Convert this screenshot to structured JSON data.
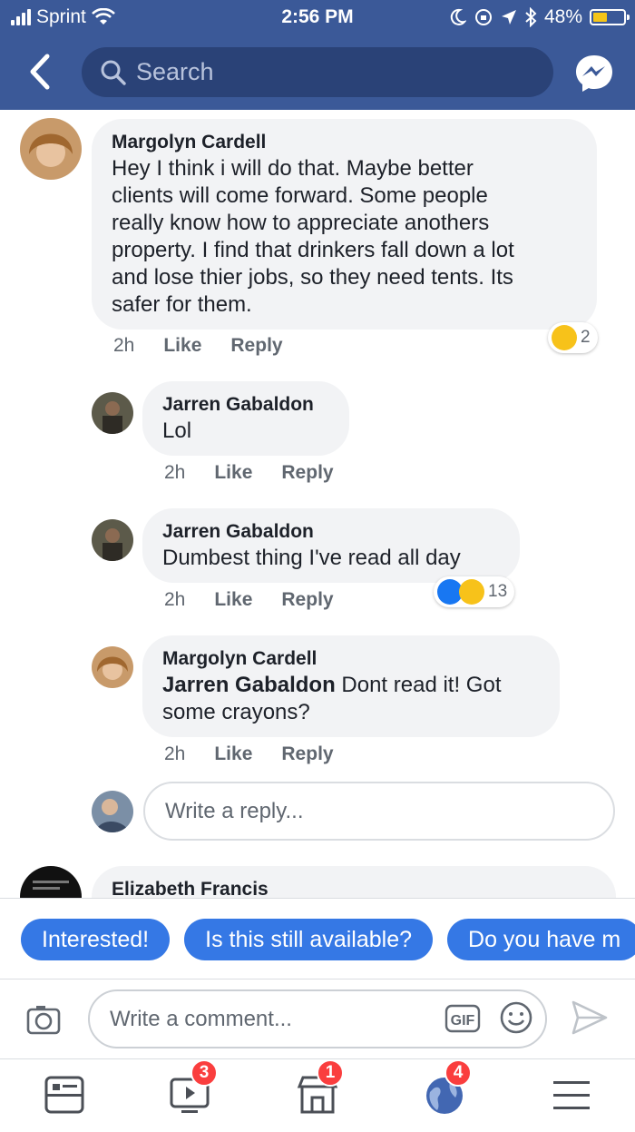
{
  "status_bar": {
    "carrier": "Sprint",
    "time": "2:56 PM",
    "battery_percent": "48%",
    "battery_level": 0.48
  },
  "nav": {
    "search_placeholder": "Search",
    "back_icon": "back-chevron-icon",
    "messenger_icon": "messenger-icon"
  },
  "comments": [
    {
      "author": "Margolyn Cardell",
      "lines": [
        "Hey I think i will do that. Maybe better",
        "clients will come forward. Some people",
        "really know how to appreciate anothers",
        "property. I find that drinkers fall down a lot",
        "and lose thier jobs, so they need tents. Its",
        "safer for them."
      ],
      "time": "2h",
      "like": "Like",
      "reply": "Reply",
      "reaction_count": "2"
    },
    {
      "author": "Jarren Gabaldon",
      "text": "Lol",
      "time": "2h",
      "like": "Like",
      "reply": "Reply"
    },
    {
      "author": "Jarren Gabaldon",
      "text": "Dumbest thing I've read all day",
      "time": "2h",
      "like": "Like",
      "reply": "Reply",
      "reaction_count": "13"
    },
    {
      "author": "Margolyn Cardell",
      "mention": "Jarren Gabaldon",
      "text_after_mention": " Dont read it! Got",
      "text_line2": "some crayons?",
      "time": "2h",
      "like": "Like",
      "reply": "Reply"
    }
  ],
  "reply_placeholder": "Write a reply...",
  "next_comment_author": "Elizabeth Francis",
  "quick_replies": [
    "Interested!",
    "Is this still available?",
    "Do you have m"
  ],
  "composer": {
    "placeholder": "Write a comment...",
    "gif_label": "GIF"
  },
  "tabbar": {
    "video_badge": "3",
    "marketplace_badge": "1",
    "notifications_badge": "4"
  },
  "colors": {
    "brand_blue": "#3b5998",
    "chip_blue": "#3578e5",
    "badge_red": "#fa3e3e"
  }
}
